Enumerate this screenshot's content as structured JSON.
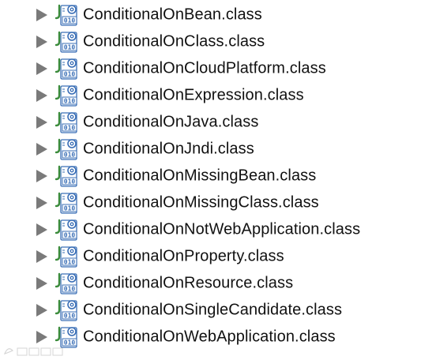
{
  "tree": {
    "items": [
      {
        "label": "ConditionalOnBean.class",
        "icon": "class-file-icon",
        "expander": "expand-arrow-icon"
      },
      {
        "label": "ConditionalOnClass.class",
        "icon": "class-file-icon",
        "expander": "expand-arrow-icon"
      },
      {
        "label": "ConditionalOnCloudPlatform.class",
        "icon": "class-file-icon",
        "expander": "expand-arrow-icon"
      },
      {
        "label": "ConditionalOnExpression.class",
        "icon": "class-file-icon",
        "expander": "expand-arrow-icon"
      },
      {
        "label": "ConditionalOnJava.class",
        "icon": "class-file-icon",
        "expander": "expand-arrow-icon"
      },
      {
        "label": "ConditionalOnJndi.class",
        "icon": "class-file-icon",
        "expander": "expand-arrow-icon"
      },
      {
        "label": "ConditionalOnMissingBean.class",
        "icon": "class-file-icon",
        "expander": "expand-arrow-icon"
      },
      {
        "label": "ConditionalOnMissingClass.class",
        "icon": "class-file-icon",
        "expander": "expand-arrow-icon"
      },
      {
        "label": "ConditionalOnNotWebApplication.class",
        "icon": "class-file-icon",
        "expander": "expand-arrow-icon"
      },
      {
        "label": "ConditionalOnProperty.class",
        "icon": "class-file-icon",
        "expander": "expand-arrow-icon"
      },
      {
        "label": "ConditionalOnResource.class",
        "icon": "class-file-icon",
        "expander": "expand-arrow-icon"
      },
      {
        "label": "ConditionalOnSingleCandidate.class",
        "icon": "class-file-icon",
        "expander": "expand-arrow-icon"
      },
      {
        "label": "ConditionalOnWebApplication.class",
        "icon": "class-file-icon",
        "expander": "expand-arrow-icon"
      }
    ]
  },
  "colors": {
    "text": "#111111",
    "arrow": "#7a7a7a",
    "icon_blue": "#3b6fb6",
    "icon_green": "#3c8c3c"
  },
  "watermark": {
    "icon": "watermark-logo-icon"
  }
}
